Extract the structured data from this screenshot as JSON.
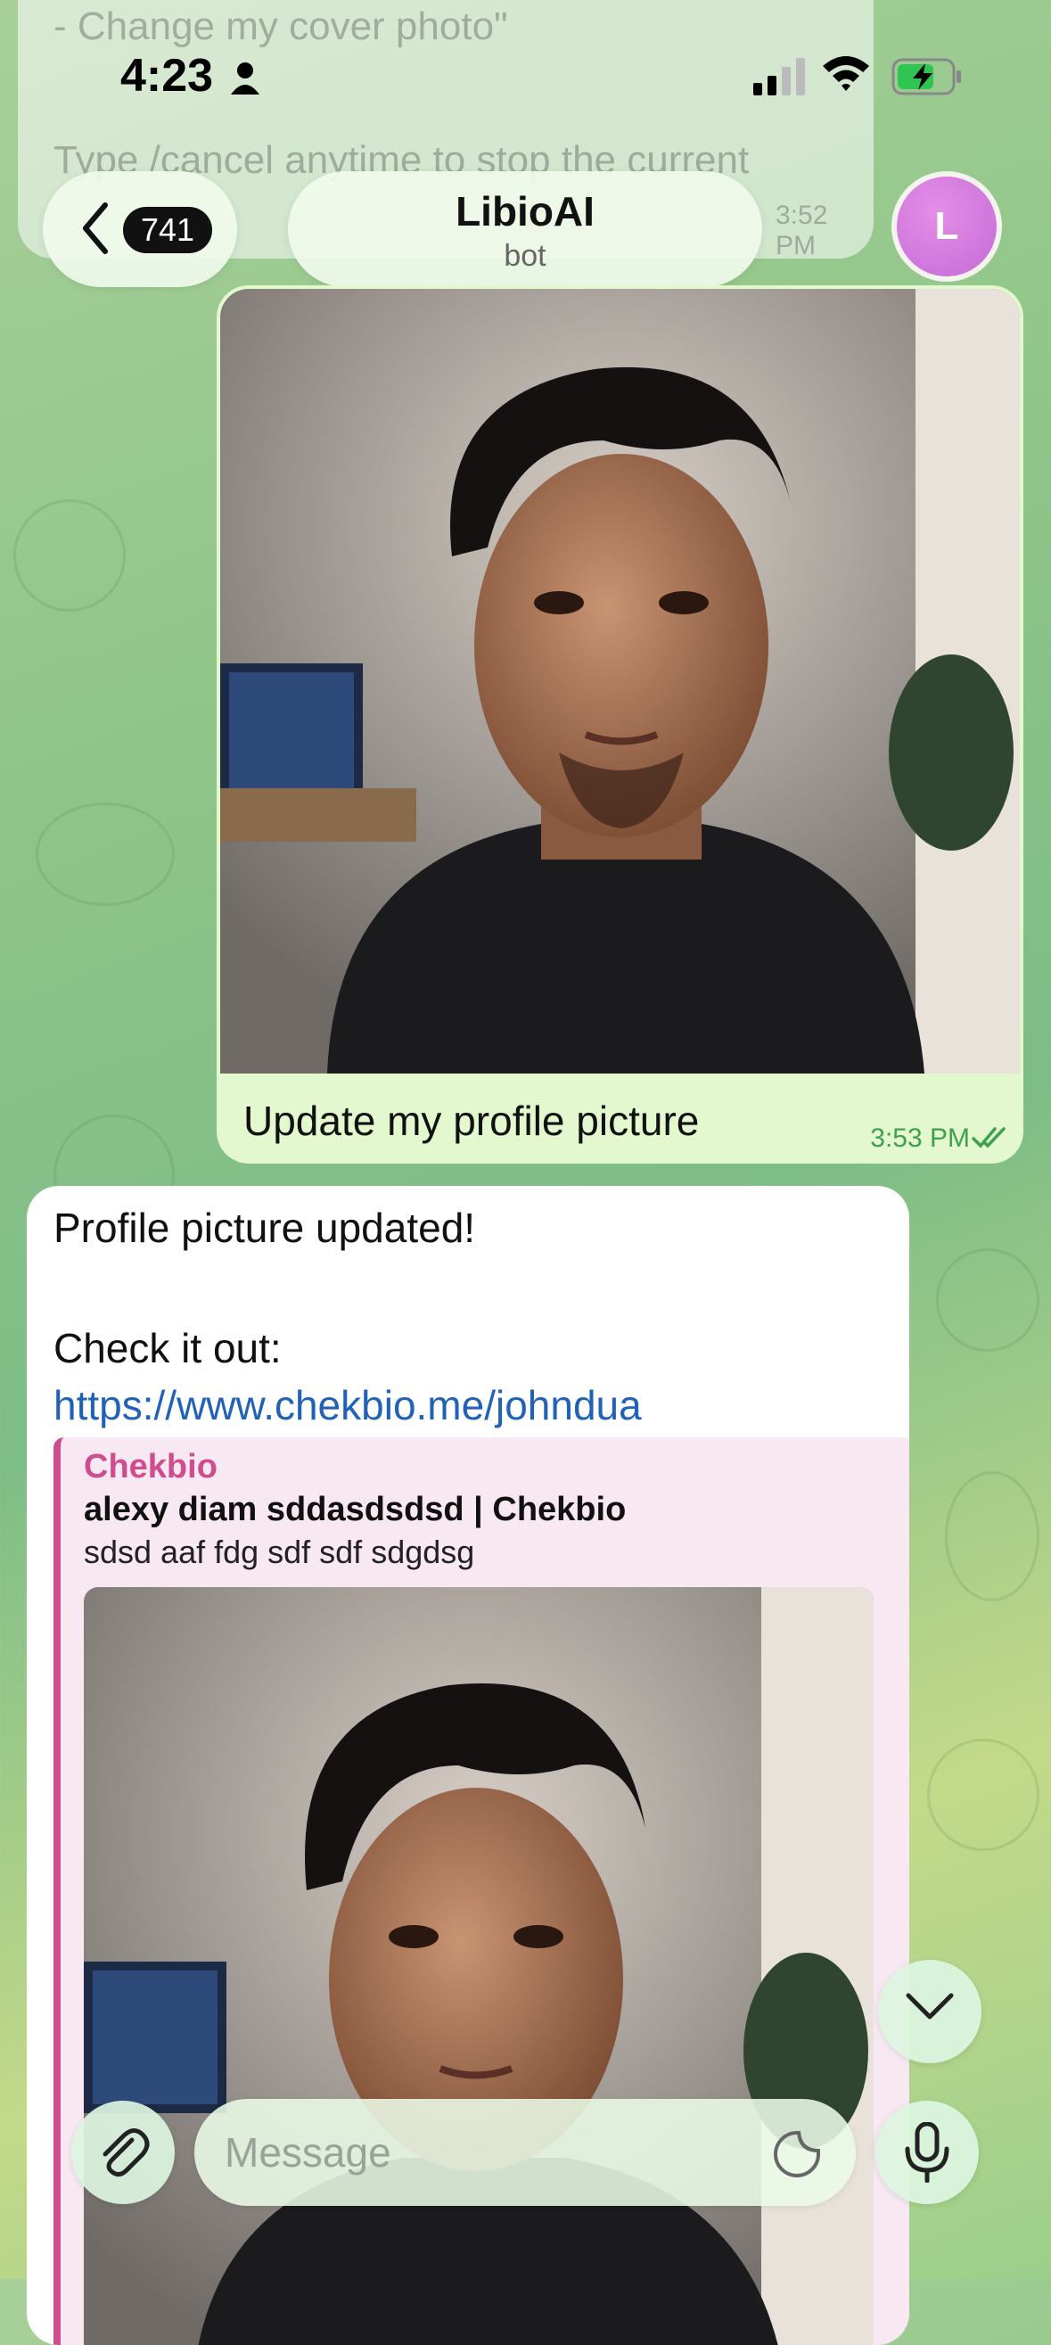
{
  "status_bar": {
    "time": "4:23"
  },
  "header": {
    "back_count": "741",
    "title": "LibioAI",
    "subtitle": "bot",
    "avatar_letter": "L"
  },
  "previous_message": {
    "line1": "- Change my cover photo\"",
    "line2": "Type /cancel anytime to stop the current",
    "time": "3:52 PM"
  },
  "outgoing_message": {
    "caption": "Update my profile picture",
    "time": "3:53 PM"
  },
  "incoming_message": {
    "line1": "Profile picture updated!",
    "line2_prefix": "Check it out: ",
    "link": "https://www.chekbio.me/johndua",
    "preview": {
      "site": "Chekbio",
      "title": "alexy diam sddasdsdsd | Chekbio",
      "description": "sdsd aaf fdg sdf sdf sdgdsg"
    }
  },
  "composer": {
    "placeholder": "Message"
  },
  "colors": {
    "bubble_out": "#e3f8cf",
    "link": "#1f62b8",
    "preview_accent": "#cf4d8f",
    "avatar": "#d47ae0"
  }
}
